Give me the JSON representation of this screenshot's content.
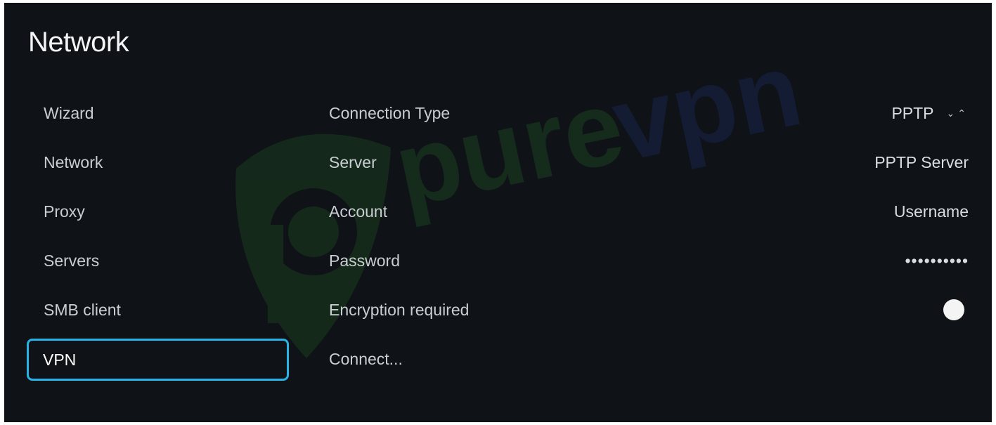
{
  "page": {
    "title": "Network"
  },
  "sidebar": {
    "items": [
      {
        "label": "Wizard"
      },
      {
        "label": "Network"
      },
      {
        "label": "Proxy"
      },
      {
        "label": "Servers"
      },
      {
        "label": "SMB client"
      },
      {
        "label": "VPN"
      }
    ],
    "selected": "VPN"
  },
  "settings": {
    "connection_type": {
      "label": "Connection Type",
      "value": "PPTP",
      "icon": "chevron-up-down-icon"
    },
    "server": {
      "label": "Server",
      "value": "PPTP Server"
    },
    "account": {
      "label": "Account",
      "value": "Username"
    },
    "password": {
      "label": "Password",
      "value": "••••••••••"
    },
    "encryption": {
      "label": "Encryption required",
      "enabled": true
    },
    "connect": {
      "label": "Connect..."
    }
  },
  "watermark": {
    "text": "purevpn"
  },
  "colors": {
    "background": "#0f1216",
    "focus": "#27b3e6",
    "watermark_green": "#2a7a2e",
    "watermark_blue": "#1e2f6e"
  }
}
